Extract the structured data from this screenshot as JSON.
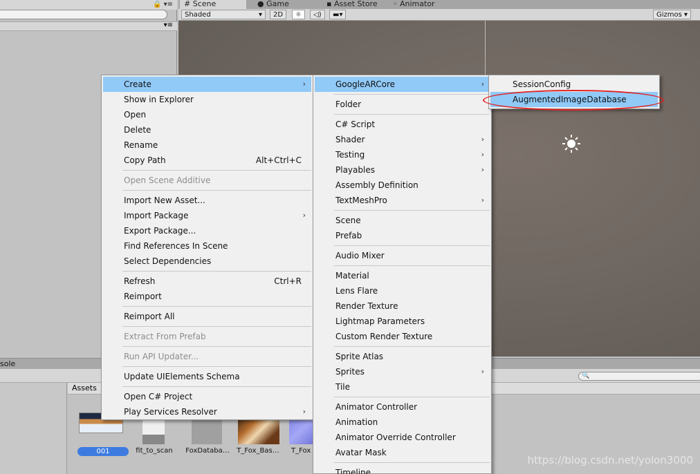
{
  "left_panel": {
    "top_icons": "🔒 ▾≡",
    "menu_icon": "▾≡"
  },
  "scene_window": {
    "tabs": [
      "# Scene",
      "Game",
      "Asset Store",
      "Animator"
    ],
    "shading_mode": "Shaded",
    "btn_2d": "2D",
    "gizmos": "Gizmos"
  },
  "console_tab": "sole",
  "project": {
    "breadcrumb": "Assets",
    "search_placeholder": "🔍",
    "assets": [
      "001",
      "fit_to_scan",
      "FoxDataba…",
      "T_Fox_Bas…",
      "T_Fox"
    ]
  },
  "watermark": "https://blog.csdn.net/yolon3000",
  "context_menu": {
    "items": [
      {
        "label": "Create",
        "submenu": true,
        "highlighted": true
      },
      {
        "label": "Show in Explorer"
      },
      {
        "label": "Open"
      },
      {
        "label": "Delete"
      },
      {
        "label": "Rename"
      },
      {
        "label": "Copy Path",
        "shortcut": "Alt+Ctrl+C"
      },
      {
        "label": "Open Scene Additive",
        "disabled": true
      },
      {
        "label": "Import New Asset..."
      },
      {
        "label": "Import Package",
        "submenu": true
      },
      {
        "label": "Export Package..."
      },
      {
        "label": "Find References In Scene"
      },
      {
        "label": "Select Dependencies"
      },
      {
        "label": "Refresh",
        "shortcut": "Ctrl+R"
      },
      {
        "label": "Reimport"
      },
      {
        "label": "Reimport All"
      },
      {
        "label": "Extract From Prefab",
        "disabled": true
      },
      {
        "label": "Run API Updater...",
        "disabled": true
      },
      {
        "label": "Update UIElements Schema"
      },
      {
        "label": "Open C# Project"
      },
      {
        "label": "Play Services Resolver",
        "submenu": true
      }
    ]
  },
  "create_menu": {
    "items": [
      {
        "label": "GoogleARCore",
        "submenu": true,
        "highlighted": true
      },
      {
        "label": "Folder"
      },
      {
        "label": "C# Script"
      },
      {
        "label": "Shader",
        "submenu": true
      },
      {
        "label": "Testing",
        "submenu": true
      },
      {
        "label": "Playables",
        "submenu": true
      },
      {
        "label": "Assembly Definition"
      },
      {
        "label": "TextMeshPro",
        "submenu": true
      },
      {
        "label": "Scene"
      },
      {
        "label": "Prefab"
      },
      {
        "label": "Audio Mixer"
      },
      {
        "label": "Material"
      },
      {
        "label": "Lens Flare"
      },
      {
        "label": "Render Texture"
      },
      {
        "label": "Lightmap Parameters"
      },
      {
        "label": "Custom Render Texture"
      },
      {
        "label": "Sprite Atlas"
      },
      {
        "label": "Sprites",
        "submenu": true
      },
      {
        "label": "Tile"
      },
      {
        "label": "Animator Controller"
      },
      {
        "label": "Animation"
      },
      {
        "label": "Animator Override Controller"
      },
      {
        "label": "Avatar Mask"
      },
      {
        "label": "Timeline"
      }
    ]
  },
  "arcore_menu": {
    "items": [
      {
        "label": "SessionConfig"
      },
      {
        "label": "AugmentedImageDatabase",
        "highlighted": true
      }
    ]
  },
  "glyphs": {
    "submenu_arrow": "›"
  }
}
